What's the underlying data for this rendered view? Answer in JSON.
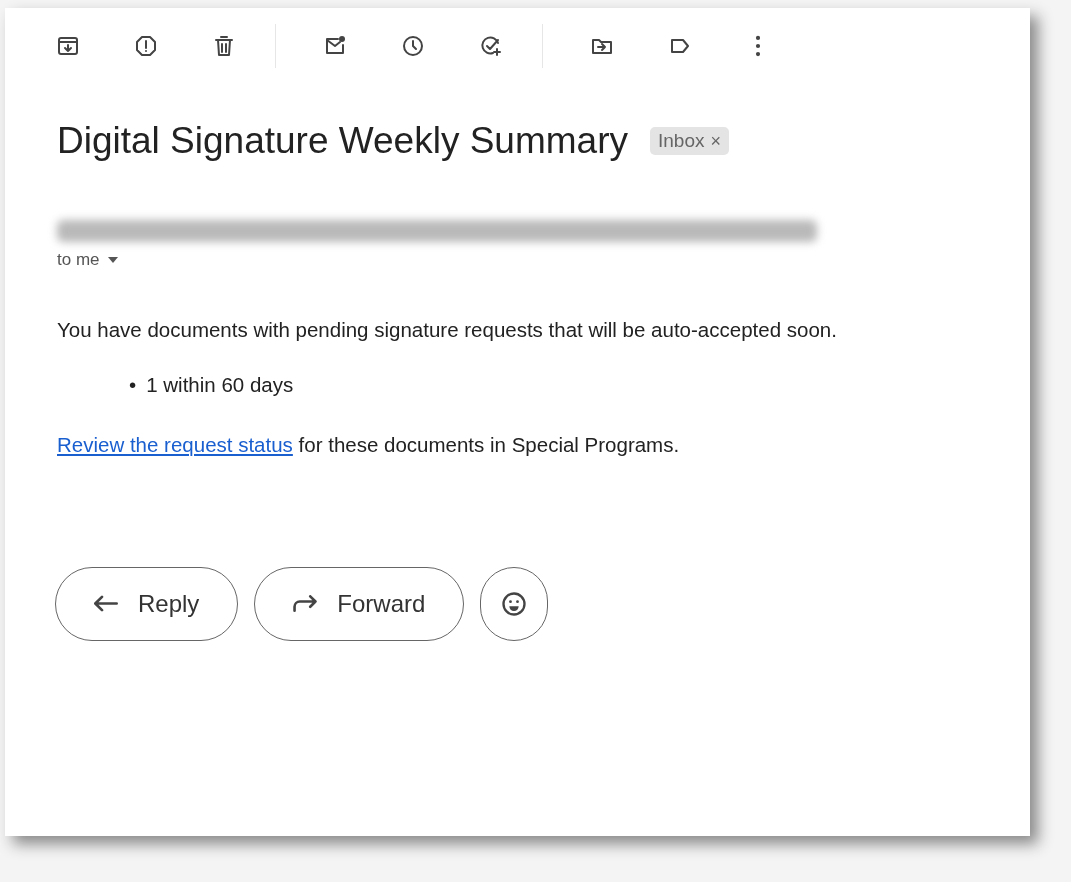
{
  "subject": "Digital Signature Weekly Summary",
  "label": {
    "text": "Inbox",
    "remove": "×"
  },
  "recipient": "to me",
  "body": {
    "intro": "You have documents with pending signature requests that will be auto-accepted soon.",
    "bullets": [
      {
        "marker": "•",
        "text": "1 within 60 days"
      }
    ],
    "link": "Review the request status",
    "after_link": " for these documents in Special Programs."
  },
  "buttons": [
    {
      "kind": "reply",
      "label": "Reply"
    },
    {
      "kind": "forward",
      "label": "Forward"
    },
    {
      "kind": "emoji"
    }
  ]
}
